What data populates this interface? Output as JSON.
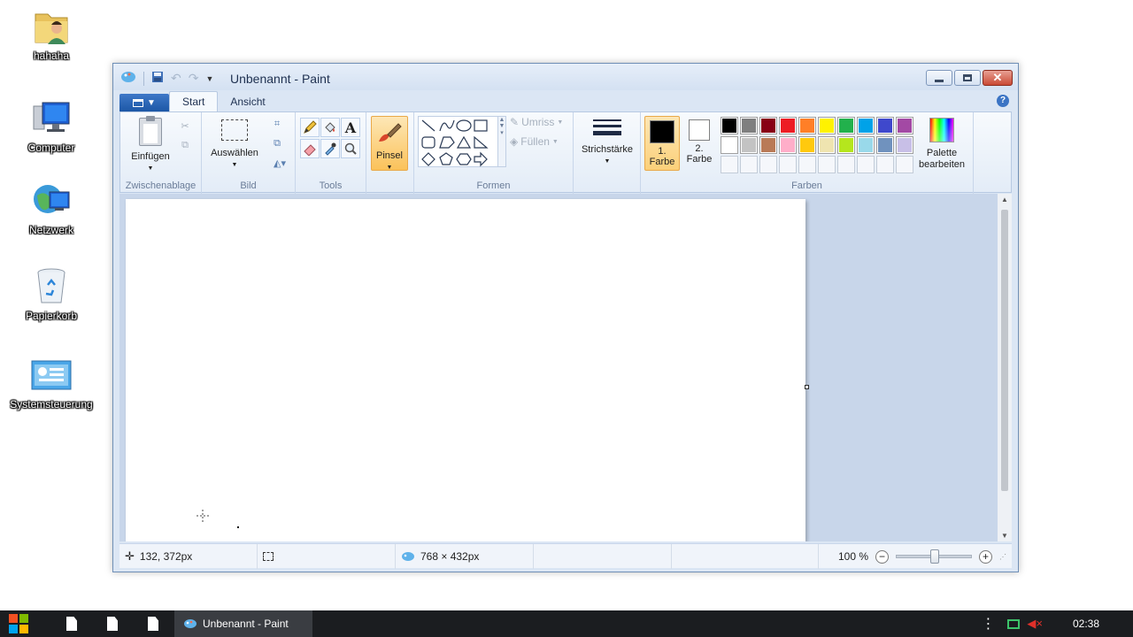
{
  "desktop": {
    "icons": [
      {
        "label": "hahaha",
        "icon": "user-folder-icon"
      },
      {
        "label": "Computer",
        "icon": "computer-icon"
      },
      {
        "label": "Netzwerk",
        "icon": "network-icon"
      },
      {
        "label": "Papierkorb",
        "icon": "recycle-bin-icon"
      },
      {
        "label": "Systemsteuerung",
        "icon": "control-panel-icon"
      }
    ]
  },
  "window": {
    "title": "Unbenannt - Paint",
    "tabs": [
      "Start",
      "Ansicht"
    ],
    "active_tab": "Start"
  },
  "ribbon": {
    "clipboard": {
      "paste_label": "Einfügen",
      "group_label": "Zwischenablage"
    },
    "image": {
      "select_label": "Auswählen",
      "group_label": "Bild"
    },
    "tools": {
      "group_label": "Tools"
    },
    "brush": {
      "label": "Pinsel"
    },
    "shapes": {
      "outline_label": "Umriss",
      "fill_label": "Füllen",
      "group_label": "Formen"
    },
    "size": {
      "label": "Strichstärke"
    },
    "colors": {
      "color1_line1": "1.",
      "color1_line2": "Farbe",
      "color2_line1": "2.",
      "color2_line2": "Farbe",
      "edit_line1": "Palette",
      "edit_line2": "bearbeiten",
      "group_label": "Farben",
      "color1_value": "#000000",
      "color2_value": "#ffffff",
      "palette_row1": [
        "#000000",
        "#7f7f7f",
        "#880015",
        "#ed1c24",
        "#ff7f27",
        "#fff200",
        "#22b14c",
        "#00a2e8",
        "#3f48cc",
        "#a349a4"
      ],
      "palette_row2": [
        "#ffffff",
        "#c3c3c3",
        "#b97a57",
        "#ffaec9",
        "#ffc90e",
        "#efe4b0",
        "#b5e61d",
        "#99d9ea",
        "#7092be",
        "#c8bfe7"
      ]
    }
  },
  "status": {
    "cursor_pos": "132, 372px",
    "canvas_size": "768 × 432px",
    "zoom": "100 %"
  },
  "taskbar": {
    "task_label": "Unbenannt - Paint",
    "clock": "02:38"
  }
}
